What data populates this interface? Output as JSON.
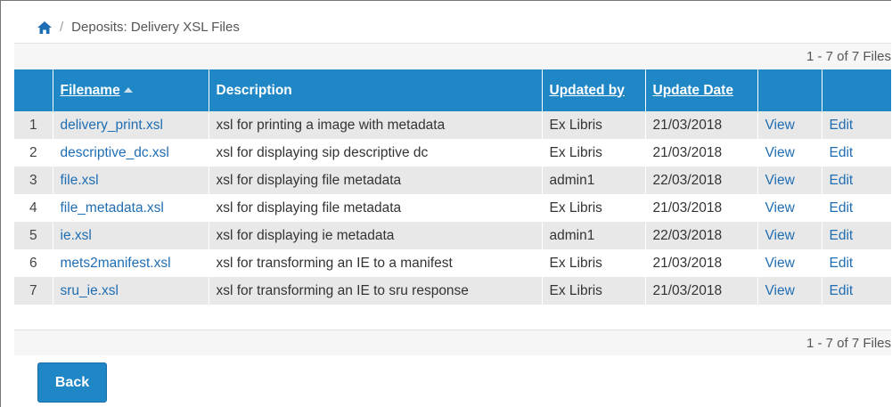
{
  "breadcrumb": {
    "separator": "/",
    "title": "Deposits: Delivery XSL Files"
  },
  "pager": {
    "text": "1 - 7 of 7 Files"
  },
  "table": {
    "columns": [
      "Filename",
      "Description",
      "Updated by",
      "Update Date",
      "",
      ""
    ],
    "rows": [
      {
        "num": "1",
        "filename": "delivery_print.xsl",
        "description": "xsl for printing a image with metadata",
        "updated_by": "Ex Libris",
        "date": "21/03/2018",
        "view": "View",
        "edit": "Edit"
      },
      {
        "num": "2",
        "filename": "descriptive_dc.xsl",
        "description": "xsl for displaying sip descriptive dc",
        "updated_by": "Ex Libris",
        "date": "21/03/2018",
        "view": "View",
        "edit": "Edit"
      },
      {
        "num": "3",
        "filename": "file.xsl",
        "description": "xsl for displaying file metadata",
        "updated_by": "admin1",
        "date": "22/03/2018",
        "view": "View",
        "edit": "Edit"
      },
      {
        "num": "4",
        "filename": "file_metadata.xsl",
        "description": "xsl for displaying file metadata",
        "updated_by": "Ex Libris",
        "date": "21/03/2018",
        "view": "View",
        "edit": "Edit"
      },
      {
        "num": "5",
        "filename": "ie.xsl",
        "description": "xsl for displaying ie metadata",
        "updated_by": "admin1",
        "date": "22/03/2018",
        "view": "View",
        "edit": "Edit"
      },
      {
        "num": "6",
        "filename": "mets2manifest.xsl",
        "description": "xsl for transforming an IE to a manifest",
        "updated_by": "Ex Libris",
        "date": "21/03/2018",
        "view": "View",
        "edit": "Edit"
      },
      {
        "num": "7",
        "filename": "sru_ie.xsl",
        "description": "xsl for transforming an IE to sru response",
        "updated_by": "Ex Libris",
        "date": "21/03/2018",
        "view": "View",
        "edit": "Edit"
      }
    ]
  },
  "actions": {
    "back_label": "Back"
  },
  "colors": {
    "header_blue": "#1f87c6",
    "link_blue": "#1f6db3",
    "row_alt": "#e8e8e8"
  }
}
